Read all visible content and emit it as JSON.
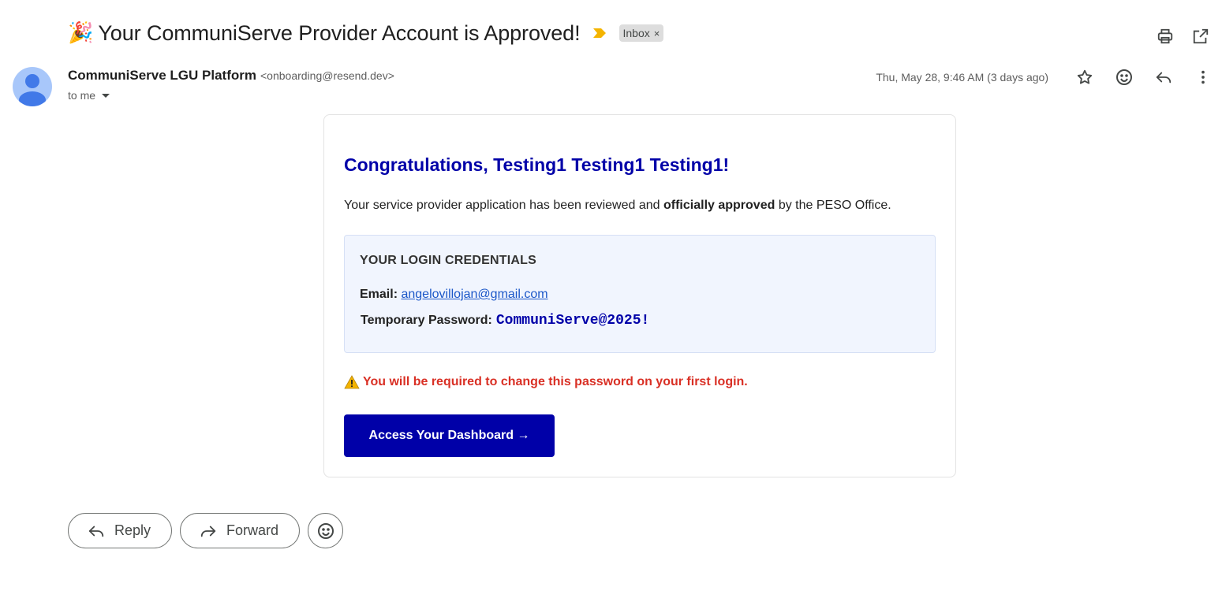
{
  "email": {
    "subject_emoji": "🎉",
    "subject": "Your CommuniServe Provider Account is Approved!",
    "label": "Inbox",
    "label_remove": "×",
    "sender_name": "CommuniServe LGU Platform",
    "sender_email": "<onboarding@resend.dev>",
    "recipient": "to me",
    "date": "Thu, May 28, 9:46 AM (3 days ago)"
  },
  "body": {
    "greeting": "Congratulations, Testing1 Testing1 Testing1!",
    "intro_prefix": "Your service provider application has been reviewed and ",
    "intro_bold": "officially approved",
    "intro_suffix": " by the PESO Office.",
    "credentials_title": "YOUR LOGIN CREDENTIALS",
    "email_label": "Email:",
    "email_value": "angelovillojan@gmail.com",
    "password_label": "Temporary Password:",
    "password_value": "CommuniServe@2025!",
    "warning": "You will be required to change this password on your first login.",
    "cta_label": "Access Your Dashboard →"
  },
  "actions": {
    "reply": "Reply",
    "forward": "Forward"
  },
  "icons": {
    "top": [
      "print-icon",
      "open-in-new-window-icon"
    ],
    "meta": [
      "star-icon",
      "emoji-reaction-icon",
      "reply-icon",
      "more-vert-icon"
    ],
    "importance": "importance-marker-icon"
  },
  "colors": {
    "brand_blue": "#0000a8",
    "warning_red": "#d93025",
    "link_blue": "#1a56c8",
    "credentials_bg": "#f1f5fe",
    "importance_yellow": "#f4b400",
    "avatar_bg": "#a8c7fa"
  }
}
